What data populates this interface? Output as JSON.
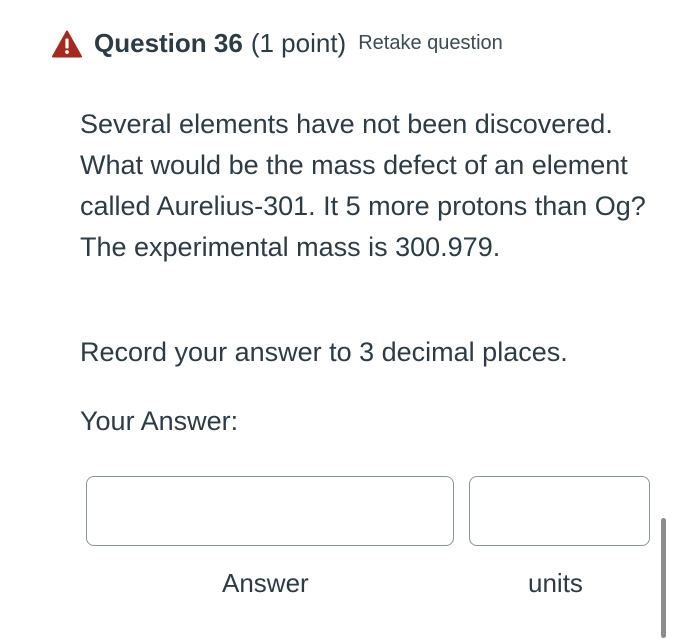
{
  "header": {
    "icon": "warning-icon",
    "title": "Question 36",
    "points": "(1 point)",
    "retake_label": "Retake question"
  },
  "question": {
    "text": "Several elements have not been discovered. What would be the mass defect of an element called Aurelius-301.  It 5 more protons than Og?  The experimental mass is 300.979.",
    "instruction": "Record your answer to 3 decimal places."
  },
  "answer": {
    "prompt": "Your Answer:",
    "answer_value": "",
    "units_value": "",
    "answer_label": "Answer",
    "units_label": "units"
  },
  "colors": {
    "warning": "#a32a1e",
    "text": "#2d3b45",
    "border": "#8a949c"
  }
}
